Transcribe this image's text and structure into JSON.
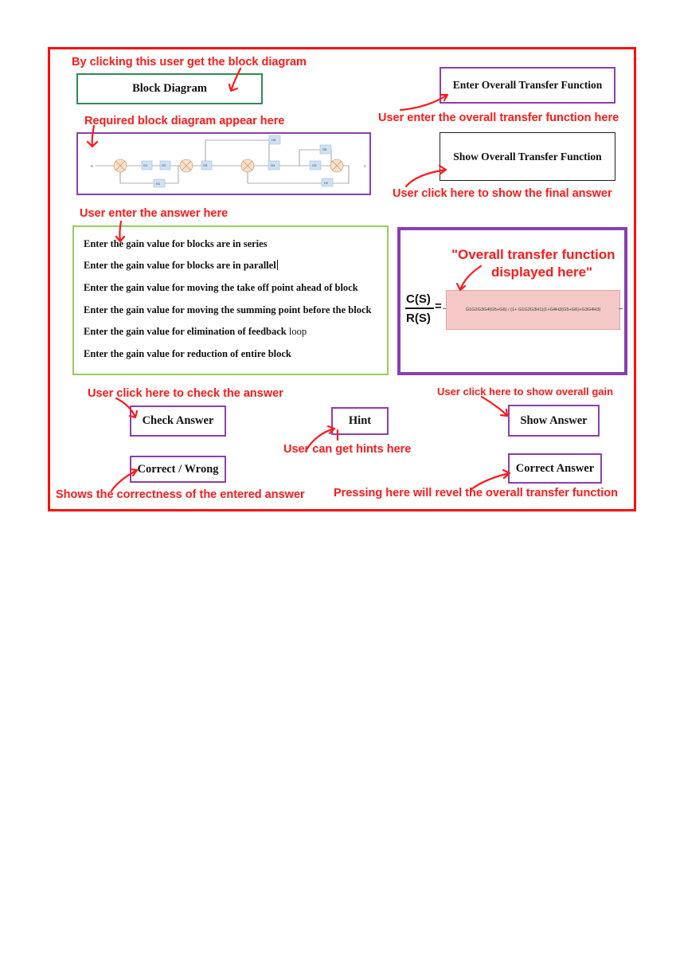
{
  "colors": {
    "frame": "#ff0d0d",
    "annotation": "#ff1a1a",
    "purple_border": "#8b3fb0",
    "green_border": "#2e8b57",
    "light_green_border": "#9acd5a",
    "tf_box_fill": "#f5c8c8",
    "diagram_block_fill": "#cfe2f5",
    "summing_junction_fill": "#fce0c8"
  },
  "annotations": {
    "block_diagram_click": "By clicking this user get the block diagram",
    "enter_tf": "User enter the overall transfer function here",
    "diagram_appear": "Required block diagram appear here",
    "show_final": "User click here to show the final answer",
    "enter_answer": "User enter the answer here",
    "tf_displayed_line1": "\"Overall transfer function",
    "tf_displayed_line2": "displayed here\"",
    "check_answer": "User click here to check the answer",
    "show_gain": "User click here to show overall gain",
    "get_hints": "User can get hints here",
    "correctness": "Shows the correctness of the entered answer",
    "reveal_tf": "Pressing here will revel the overall transfer function"
  },
  "buttons": {
    "block_diagram": "Block Diagram",
    "enter_overall_tf": "Enter Overall Transfer Function",
    "show_overall_tf": "Show Overall Transfer Function",
    "check_answer": "Check Answer",
    "hint": "Hint",
    "show_answer": "Show Answer",
    "correct_wrong": "Correct / Wrong",
    "correct_answer": "Correct Answer"
  },
  "gain_inputs": [
    {
      "bold": "Enter the gain value for blocks are in series",
      "normal": ""
    },
    {
      "bold": "Enter the gain value for blocks are in parallel",
      "normal": ""
    },
    {
      "bold": "Enter the gain value for moving the take off point ahead of block",
      "normal": ""
    },
    {
      "bold": "Enter the gain value for moving the summing point before the block",
      "normal": ""
    },
    {
      "bold": "Enter the gain value for elimination of feedback",
      "normal": " loop"
    },
    {
      "bold": "Enter the gain value for reduction of entire block",
      "normal": ""
    }
  ],
  "transfer_function": {
    "numerator": "C(S)",
    "denominator": "R(S)",
    "equals": "=",
    "expression": "G1G2G3G4(G5+G6) / (1+ G1G2G3H1)(1+G4H2(G5+G6)+G3G4H3)"
  },
  "block_diagram": {
    "input_label": "R",
    "output_label": "C",
    "forward_blocks": [
      "G1",
      "G2",
      "G3",
      "G4",
      "G5"
    ],
    "parallel_block": "G6",
    "feedback_blocks": [
      "H1",
      "H2",
      "H3"
    ]
  }
}
